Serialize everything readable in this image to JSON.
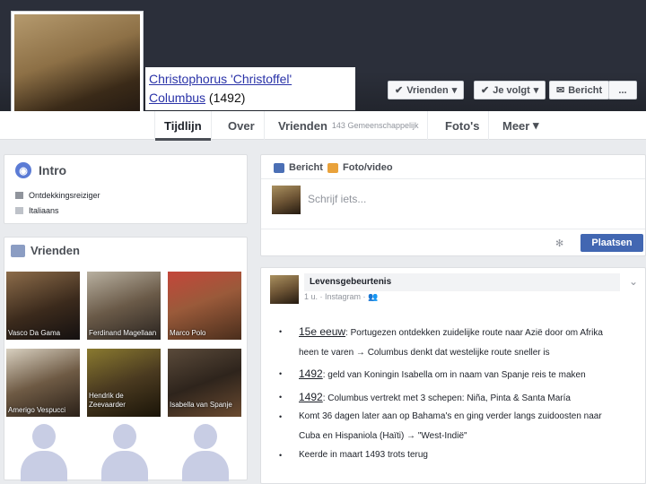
{
  "profile": {
    "name_link": "Christophorus 'Christoffel' Columbus",
    "year": "(1492)"
  },
  "header_buttons": {
    "friends": "Vrienden",
    "following": "Je volgt",
    "message": "Bericht",
    "more": "..."
  },
  "tabs": [
    {
      "label": "Tijdlijn"
    },
    {
      "label": "Over"
    },
    {
      "label": "Vrienden",
      "sub": "143 Gemeenschappelijk"
    },
    {
      "label": "Foto's"
    },
    {
      "label": "Meer"
    }
  ],
  "intro": {
    "title": "Intro",
    "rows": [
      "Ontdekkingsreiziger",
      "Italiaans"
    ]
  },
  "friends": {
    "title": "Vrienden",
    "items": [
      {
        "name": "Vasco Da Gama"
      },
      {
        "name": "Ferdinand Magellaan"
      },
      {
        "name": "Marco Polo"
      },
      {
        "name": "Amerigo Vespucci"
      },
      {
        "name": "Hendrik de Zeevaarder"
      },
      {
        "name": "Isabella van Spanje"
      }
    ]
  },
  "composer": {
    "tab_post": "Bericht",
    "tab_photo": "Foto/video",
    "placeholder": "Schrijf iets...",
    "publish": "Plaatsen"
  },
  "life_event": {
    "title": "Levensgebeurtenis",
    "meta": "1 u. · Instagram ·",
    "bullets": [
      {
        "lead": "15e eeuw",
        "rest1": ": Portugezen ontdekken zuidelijke route naar Azië door om Afrika",
        "rest2": "heen te varen → Columbus denkt dat westelijke route sneller is"
      },
      {
        "lead": "1492",
        "rest1": ": geld van Koningin Isabella om in naam van Spanje reis te maken"
      },
      {
        "lead": "1492",
        "rest1": ": Columbus vertrekt met 3 schepen: Niña, Pinta & Santa María"
      },
      {
        "lead": "",
        "rest1": "Komt 36 dagen later aan op Bahama's en ging verder langs zuidoosten naar",
        "rest2": "Cuba en Hispaniola (Haïti) → \"West-Indië\""
      },
      {
        "lead": "",
        "rest1": "Keerde in maart 1493 trots terug"
      }
    ]
  },
  "colors": {
    "accent": "#4267b2",
    "cover": "#2b2f3a"
  }
}
